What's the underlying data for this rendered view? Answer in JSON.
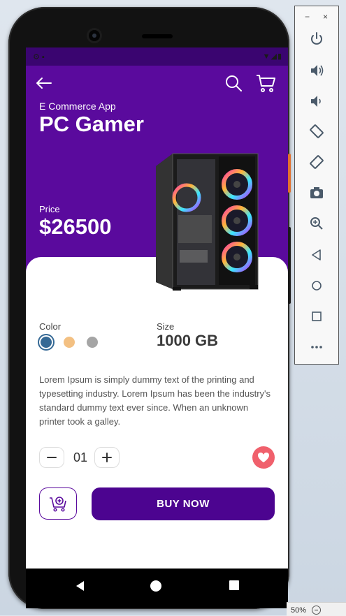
{
  "app": {
    "subtitle": "E Commerce App",
    "title": "PC Gamer",
    "price_label": "Price",
    "price": "$26500"
  },
  "product": {
    "color_label": "Color",
    "colors": [
      "#356995",
      "#f3c082",
      "#a5a5a5"
    ],
    "selected_color": "#356995",
    "size_label": "Size",
    "size_value": "1000 GB",
    "description": "Lorem Ipsum is simply dummy text of the printing and typesetting industry. Lorem Ipsum has been the industry's standard dummy text ever since. When an unknown printer took a galley.",
    "quantity": "01",
    "buy_label": "BUY  NOW"
  },
  "theme": {
    "primary": "#5a0a9d",
    "button": "#4c0490",
    "favorite": "#f0606c"
  },
  "emulator": {
    "minimize": "−",
    "close": "×",
    "tools": [
      "power-icon",
      "volume-up-icon",
      "volume-down-icon",
      "rotate-left-icon",
      "rotate-right-icon",
      "camera-icon",
      "zoom-icon",
      "back-icon",
      "home-icon",
      "overview-icon",
      "more-icon"
    ],
    "zoom_level": "50%"
  }
}
